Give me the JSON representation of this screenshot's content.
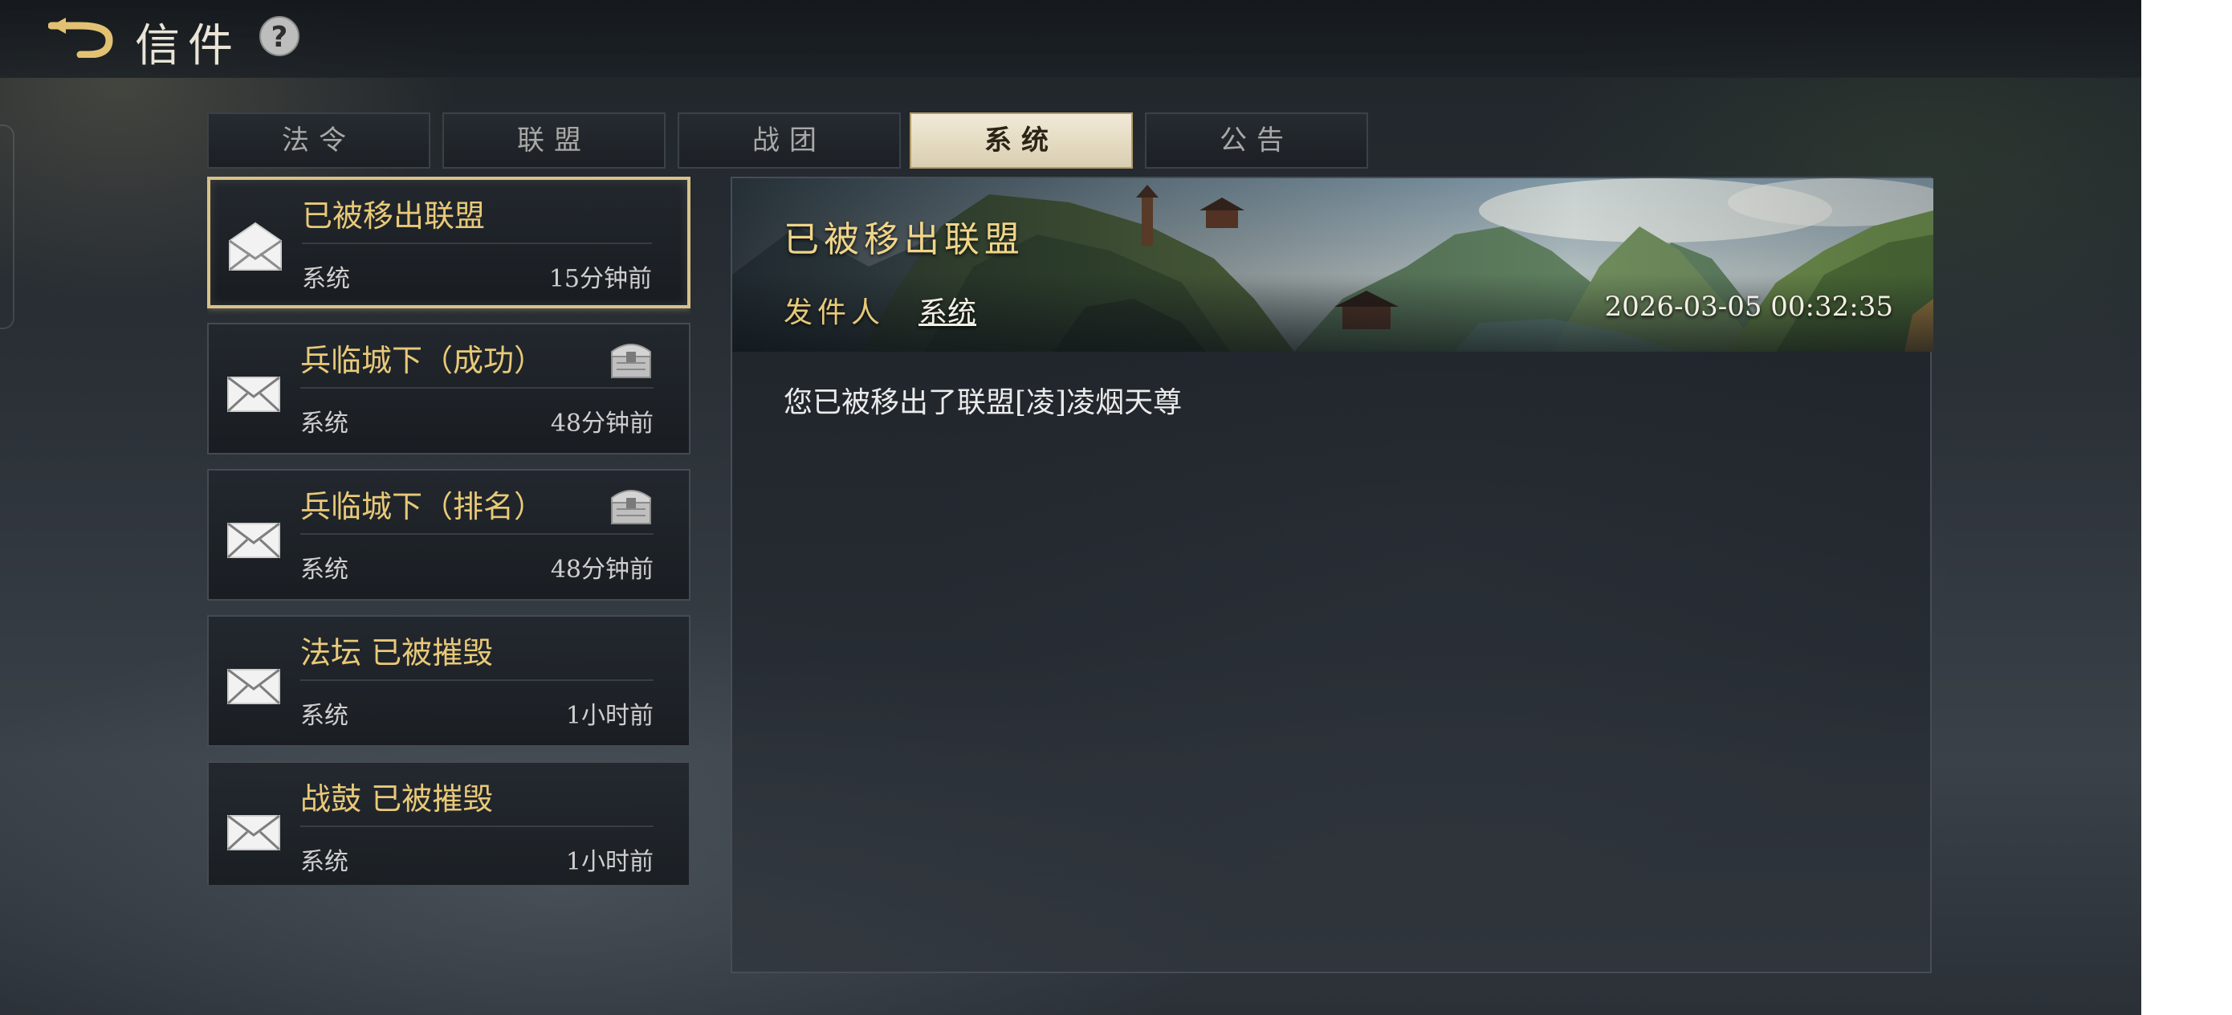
{
  "header": {
    "title": "信件"
  },
  "tabs": [
    {
      "label": "法令",
      "active": false
    },
    {
      "label": "联盟",
      "active": false
    },
    {
      "label": "战团",
      "active": false
    },
    {
      "label": "系统",
      "active": true
    },
    {
      "label": "公告",
      "active": false
    }
  ],
  "mails": [
    {
      "subject": "已被移出联盟",
      "sender": "系统",
      "time": "15分钟前",
      "opened": true,
      "attachment": false,
      "selected": true
    },
    {
      "subject": "兵临城下（成功）",
      "sender": "系统",
      "time": "48分钟前",
      "opened": false,
      "attachment": true,
      "selected": false
    },
    {
      "subject": "兵临城下（排名）",
      "sender": "系统",
      "time": "48分钟前",
      "opened": false,
      "attachment": true,
      "selected": false
    },
    {
      "subject": "法坛 已被摧毁",
      "sender": "系统",
      "time": "1小时前",
      "opened": false,
      "attachment": false,
      "selected": false
    },
    {
      "subject": "战鼓 已被摧毁",
      "sender": "系统",
      "time": "1小时前",
      "opened": false,
      "attachment": false,
      "selected": false
    }
  ],
  "detail": {
    "title": "已被移出联盟",
    "sender_label": "发件人",
    "sender": "系统",
    "timestamp": "2026-03-05 00:32:35",
    "body": "您已被移出了联盟[凌]凌烟天尊"
  },
  "colors": {
    "accent_gold": "#e8c978",
    "selected_border": "#d8c28a",
    "active_tab_bg": "#f1ead7"
  },
  "icons": {
    "back": "back-arrow-icon",
    "help": "question-mark-icon",
    "mail_closed": "envelope-closed-icon",
    "mail_open": "envelope-open-icon",
    "attachment": "treasure-chest-icon"
  }
}
